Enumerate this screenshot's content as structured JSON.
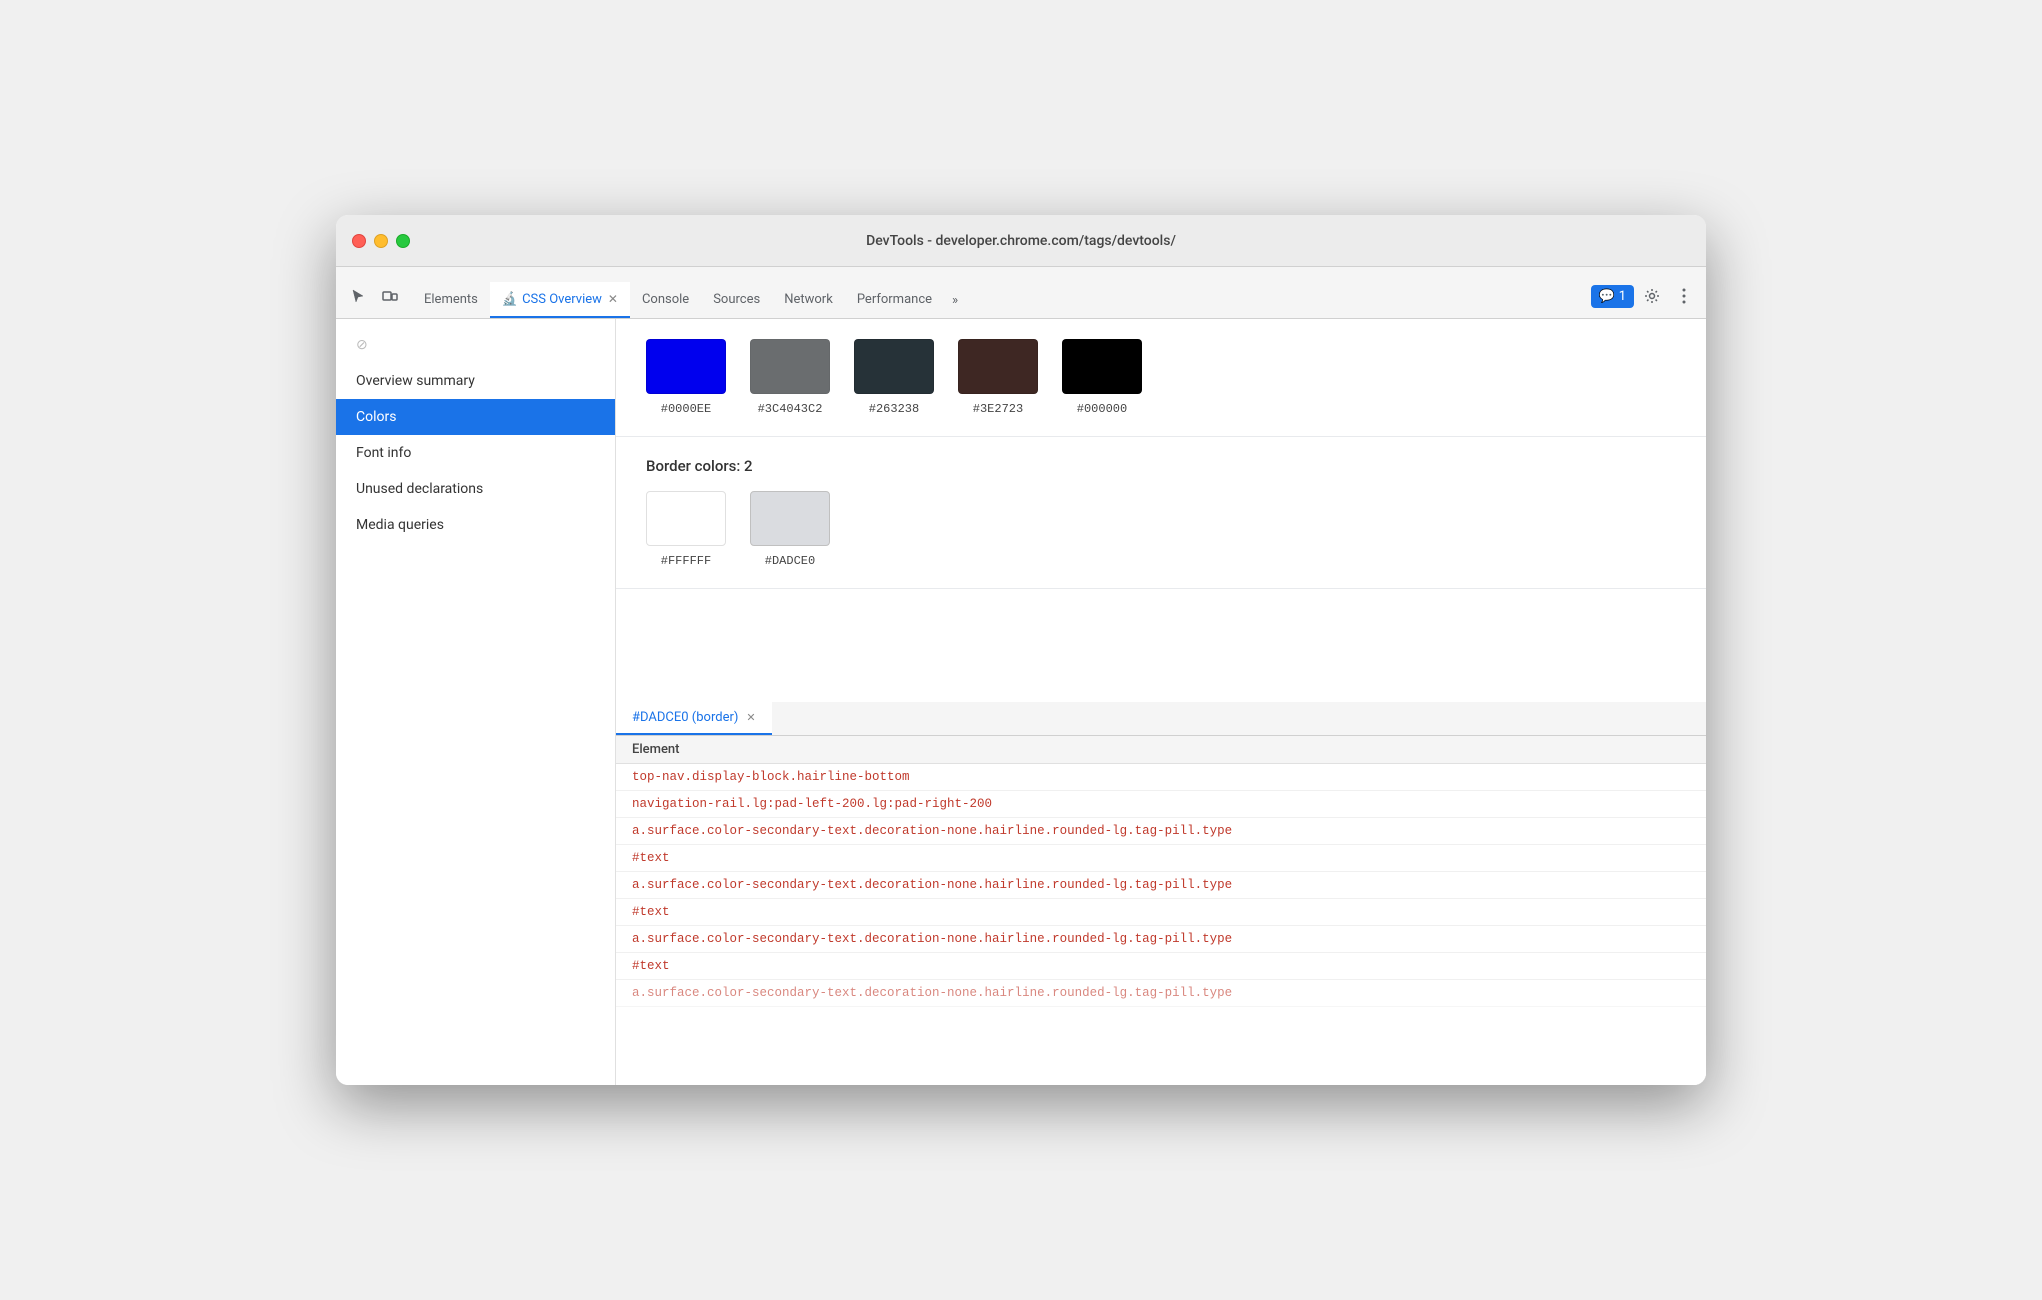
{
  "window": {
    "title": "DevTools - developer.chrome.com/tags/devtools/"
  },
  "tabs": [
    {
      "id": "elements",
      "label": "Elements",
      "active": false
    },
    {
      "id": "css-overview",
      "label": "CSS Overview",
      "active": true,
      "hasIcon": true,
      "closable": true
    },
    {
      "id": "console",
      "label": "Console",
      "active": false
    },
    {
      "id": "sources",
      "label": "Sources",
      "active": false
    },
    {
      "id": "network",
      "label": "Network",
      "active": false
    },
    {
      "id": "performance",
      "label": "Performance",
      "active": false
    }
  ],
  "tab_more": "»",
  "badge": {
    "icon": "💬",
    "count": "1"
  },
  "sidebar": {
    "disabled_label": "⊘",
    "items": [
      {
        "id": "overview-summary",
        "label": "Overview summary",
        "active": false
      },
      {
        "id": "colors",
        "label": "Colors",
        "active": true
      },
      {
        "id": "font-info",
        "label": "Font info",
        "active": false
      },
      {
        "id": "unused-declarations",
        "label": "Unused declarations",
        "active": false
      },
      {
        "id": "media-queries",
        "label": "Media queries",
        "active": false
      }
    ]
  },
  "colors_section": {
    "top_swatches": [
      {
        "hex": "#0000EE",
        "color": "#0000EE"
      },
      {
        "hex": "#3C4043C2",
        "color": "#3C4043"
      },
      {
        "hex": "#263238",
        "color": "#263238"
      },
      {
        "hex": "#3E2723",
        "color": "#3E2723"
      },
      {
        "hex": "#000000",
        "color": "#000000"
      }
    ],
    "border_title": "Border colors: 2",
    "border_swatches": [
      {
        "hex": "#FFFFFF",
        "color": "#FFFFFF"
      },
      {
        "hex": "#DADCE0",
        "color": "#DADCE0"
      }
    ]
  },
  "bottom_panel": {
    "tab_label": "#DADCE0 (border)",
    "table_header": "Element",
    "rows": [
      {
        "type": "selector",
        "text": "top-nav.display-block.hairline-bottom"
      },
      {
        "type": "selector",
        "text": "navigation-rail.lg:pad-left-200.lg:pad-right-200"
      },
      {
        "type": "selector",
        "text": "a.surface.color-secondary-text.decoration-none.hairline.rounded-lg.tag-pill.type"
      },
      {
        "type": "text",
        "text": "#text"
      },
      {
        "type": "selector",
        "text": "a.surface.color-secondary-text.decoration-none.hairline.rounded-lg.tag-pill.type"
      },
      {
        "type": "text",
        "text": "#text"
      },
      {
        "type": "selector",
        "text": "a.surface.color-secondary-text.decoration-none.hairline.rounded-lg.tag-pill.type"
      },
      {
        "type": "text",
        "text": "#text"
      },
      {
        "type": "selector",
        "text": "a.surface.color-secondary-text.decoration-none.hairline.rounded-lg.tag-pill.type"
      }
    ]
  }
}
